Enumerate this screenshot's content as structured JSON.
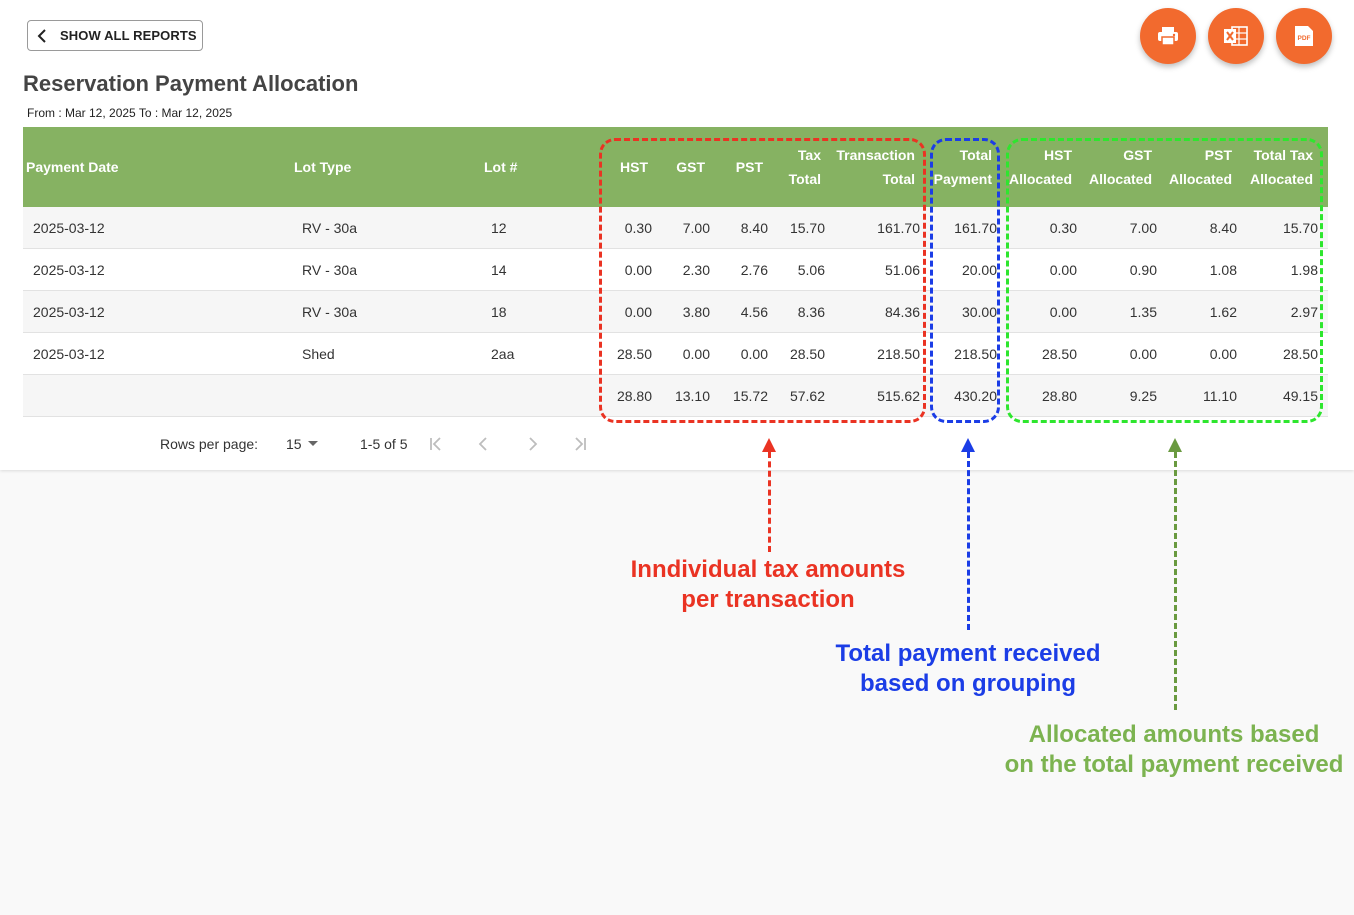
{
  "header": {
    "back_label": "SHOW ALL REPORTS",
    "title": "Reservation Payment Allocation",
    "date_range": "From : Mar 12, 2025 To : Mar 12, 2025",
    "actions": [
      {
        "name": "print-icon"
      },
      {
        "name": "excel-icon"
      },
      {
        "name": "pdf-icon",
        "text": "PDF"
      }
    ]
  },
  "table": {
    "columns": [
      {
        "key": "date",
        "line1": "",
        "line2": "Payment Date"
      },
      {
        "key": "lot_type",
        "line1": "",
        "line2": "Lot Type"
      },
      {
        "key": "lot",
        "line1": "",
        "line2": "Lot #"
      },
      {
        "key": "hst",
        "line1": "",
        "line2": "HST"
      },
      {
        "key": "gst",
        "line1": "",
        "line2": "GST"
      },
      {
        "key": "pst",
        "line1": "",
        "line2": "PST"
      },
      {
        "key": "tax_total",
        "line1": "Tax",
        "line2": "Total"
      },
      {
        "key": "trans_total",
        "line1": "Transaction",
        "line2": "Total"
      },
      {
        "key": "total_payment",
        "line1": "Total",
        "line2": "Payment"
      },
      {
        "key": "hst_alloc",
        "line1": "HST",
        "line2": "Allocated"
      },
      {
        "key": "gst_alloc",
        "line1": "GST",
        "line2": "Allocated"
      },
      {
        "key": "pst_alloc",
        "line1": "PST",
        "line2": "Allocated"
      },
      {
        "key": "tax_alloc",
        "line1": "Total Tax",
        "line2": "Allocated"
      }
    ],
    "rows": [
      [
        "2025-03-12",
        "RV - 30a",
        "12",
        "0.30",
        "7.00",
        "8.40",
        "15.70",
        "161.70",
        "161.70",
        "0.30",
        "7.00",
        "8.40",
        "15.70"
      ],
      [
        "2025-03-12",
        "RV - 30a",
        "14",
        "0.00",
        "2.30",
        "2.76",
        "5.06",
        "51.06",
        "20.00",
        "0.00",
        "0.90",
        "1.08",
        "1.98"
      ],
      [
        "2025-03-12",
        "RV - 30a",
        "18",
        "0.00",
        "3.80",
        "4.56",
        "8.36",
        "84.36",
        "30.00",
        "0.00",
        "1.35",
        "1.62",
        "2.97"
      ],
      [
        "2025-03-12",
        "Shed",
        "2aa",
        "28.50",
        "0.00",
        "0.00",
        "28.50",
        "218.50",
        "218.50",
        "28.50",
        "0.00",
        "0.00",
        "28.50"
      ],
      [
        "",
        "",
        "",
        "28.80",
        "13.10",
        "15.72",
        "57.62",
        "515.62",
        "430.20",
        "28.80",
        "9.25",
        "11.10",
        "49.15"
      ]
    ]
  },
  "pagination": {
    "rows_per_page_label": "Rows per page:",
    "rows_per_page": "15",
    "range": "1-5 of 5"
  },
  "annotations": {
    "tax": {
      "line1": "Inndividual tax amounts",
      "line2": "per transaction",
      "color": "#ea3323"
    },
    "payment": {
      "line1": "Total payment received",
      "line2": "based on grouping",
      "color": "#1b3de6"
    },
    "allocated": {
      "line1": "Allocated amounts based",
      "line2": "on the total payment received",
      "color": "#7cb350",
      "box_color": "#2ee62e"
    }
  },
  "colors": {
    "header_bg": "#86b262",
    "fab": "#f26a2e"
  }
}
